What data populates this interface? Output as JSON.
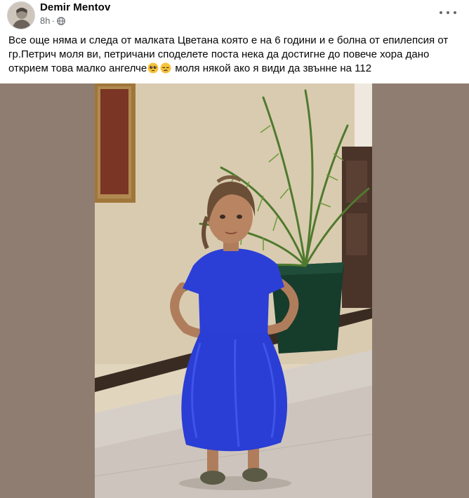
{
  "post": {
    "author": "Demir Mentov",
    "time": "8h",
    "separator": "·",
    "text_part1": "Все още няма и следа от малката Цветана която е на 6 години и е болна от епилепсия от гр.Петрич моля ви, петричани споделете поста нека да достигне до повече хора дано открием това малко ангелче",
    "text_part2": " моля някой ако я види да звънне на 112",
    "emojis": [
      "pleading-face-emoji",
      "disappointed-face-emoji"
    ],
    "privacy_icon": "globe-icon",
    "menu_icon": "more-options-icon",
    "photo_description_icon": "photo"
  },
  "colors": {
    "media_background": "#8f7d71",
    "dress": "#2b3fd6",
    "meta_text": "#65676b"
  }
}
